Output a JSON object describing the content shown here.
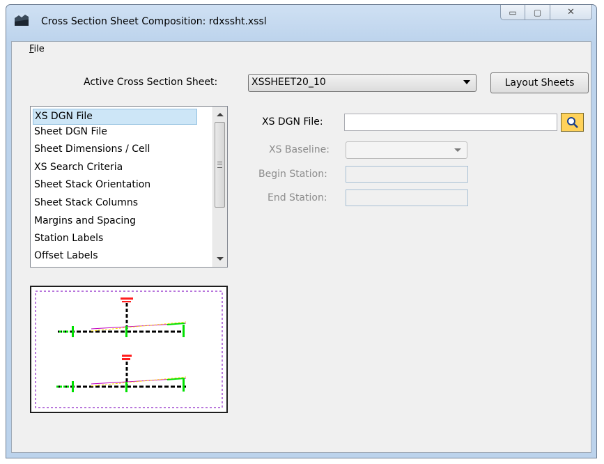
{
  "window": {
    "title": "Cross Section Sheet Composition: rdxssht.xssl",
    "controls": {
      "minimize": "▭",
      "maximize": "▢",
      "close": "✕"
    }
  },
  "menu": {
    "file_first": "F",
    "file_rest": "ile"
  },
  "active_sheet": {
    "label": "Active Cross Section Sheet:",
    "value": "XSSHEET20_10",
    "button": "Layout Sheets"
  },
  "categories": {
    "items": [
      "XS DGN File",
      "Sheet DGN File",
      "Sheet Dimensions / Cell",
      "XS Search Criteria",
      "Sheet Stack Orientation",
      "Sheet Stack Columns",
      "Margins and Spacing",
      "Station Labels",
      "Offset Labels"
    ],
    "selected_index": 0
  },
  "form": {
    "xs_dgn_file_label": "XS DGN File:",
    "xs_dgn_file_value": "",
    "xs_baseline_label": "XS Baseline:",
    "xs_baseline_value": "",
    "begin_station_label": "Begin Station:",
    "begin_station_value": "",
    "end_station_label": "End Station:",
    "end_station_value": ""
  },
  "icons": {
    "app": "cross-section-icon",
    "browse": "magnifier-icon"
  },
  "colors": {
    "selection": "#cde6f7",
    "browse_button": "#ffd25a",
    "preview_border_dash": "#8e24c7",
    "preview_ground": "#00e000"
  }
}
